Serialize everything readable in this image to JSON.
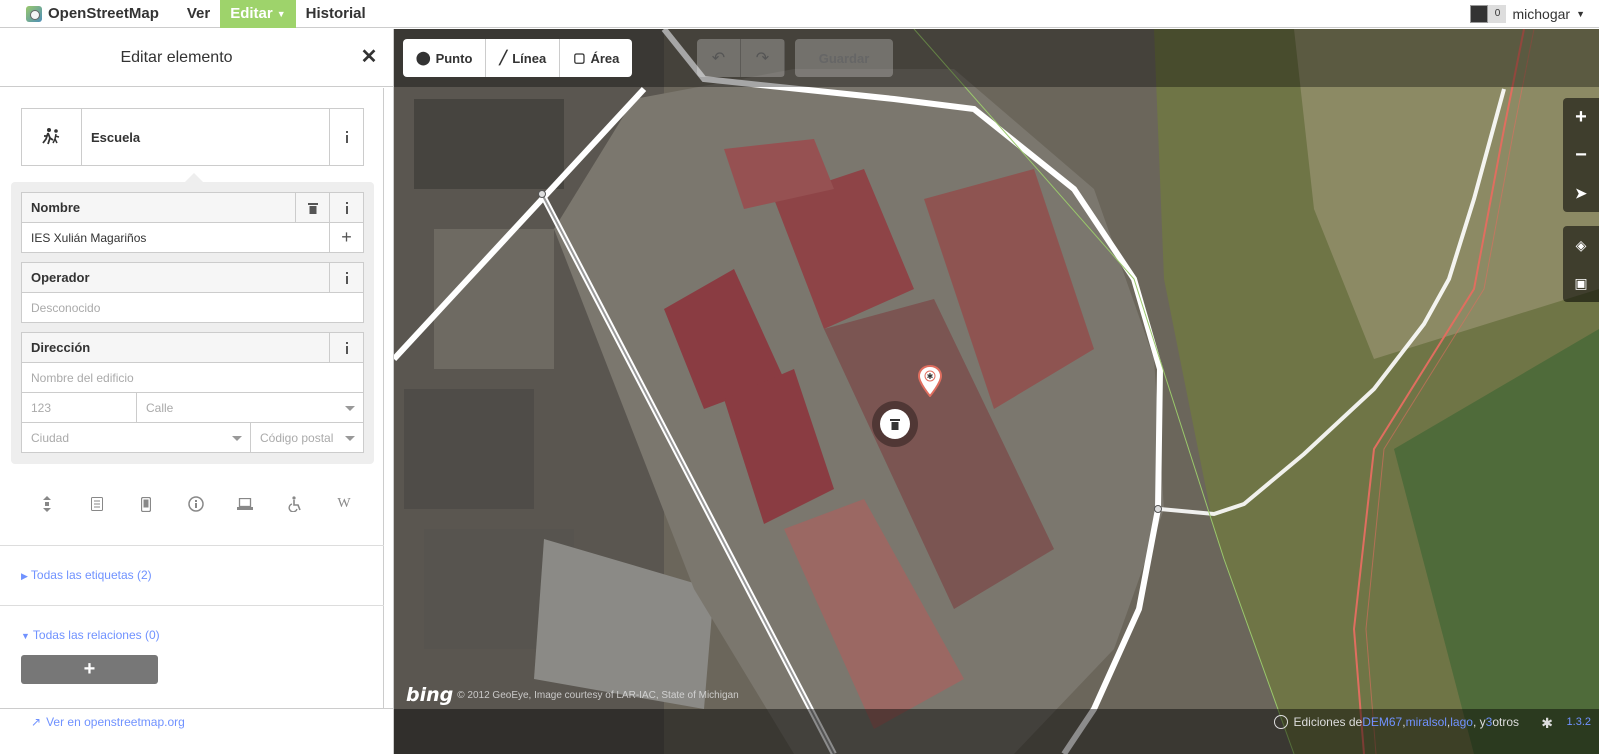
{
  "topbar": {
    "brand": "OpenStreetMap",
    "tabs": [
      {
        "label": "Ver",
        "active": false
      },
      {
        "label": "Editar",
        "active": true
      },
      {
        "label": "Historial",
        "active": false
      }
    ],
    "user": {
      "messages": "0",
      "name": "michogar"
    }
  },
  "sidebar": {
    "title": "Editar elemento",
    "preset": {
      "name": "Escuela",
      "icon": "school-pedestrian-icon"
    },
    "fields": {
      "name": {
        "label": "Nombre",
        "value": "IES Xulián Magariños"
      },
      "operator": {
        "label": "Operador",
        "placeholder": "Desconocido"
      },
      "address": {
        "label": "Dirección",
        "building_placeholder": "Nombre del edificio",
        "housenumber_placeholder": "123",
        "street_placeholder": "Calle",
        "city_placeholder": "Ciudad",
        "postcode_placeholder": "Código postal"
      }
    },
    "more_fields_icons": [
      "elevator-icon",
      "note-icon",
      "phone-icon",
      "info-icon",
      "laptop-icon",
      "wheelchair-icon",
      "wikipedia-icon"
    ],
    "all_tags": "Todas las etiquetas (2)",
    "all_relations": "Todas las relaciones (0)",
    "add_relation": "+",
    "view_link": "Ver en openstreetmap.org"
  },
  "map": {
    "modes": [
      {
        "label": "Punto",
        "icon": "point-icon"
      },
      {
        "label": "Línea",
        "icon": "line-icon"
      },
      {
        "label": "Área",
        "icon": "area-icon"
      }
    ],
    "save_label": "Guardar",
    "imagery_brand": "bing",
    "imagery_attribution": "© 2012 GeoEye, Image courtesy of LAR-IAC, State of Michigan",
    "footer": {
      "edits_prefix": "Ediciones de ",
      "user1": "DEM67",
      "user2": "miralsol",
      "user3": "lago",
      "and": ", y ",
      "others_count": "3",
      "others": " otros",
      "version": "1.3.2"
    }
  },
  "colors": {
    "accent_green": "#9ed36b",
    "link_blue": "#7092ff",
    "selected_area_red": "#e06e5f"
  }
}
